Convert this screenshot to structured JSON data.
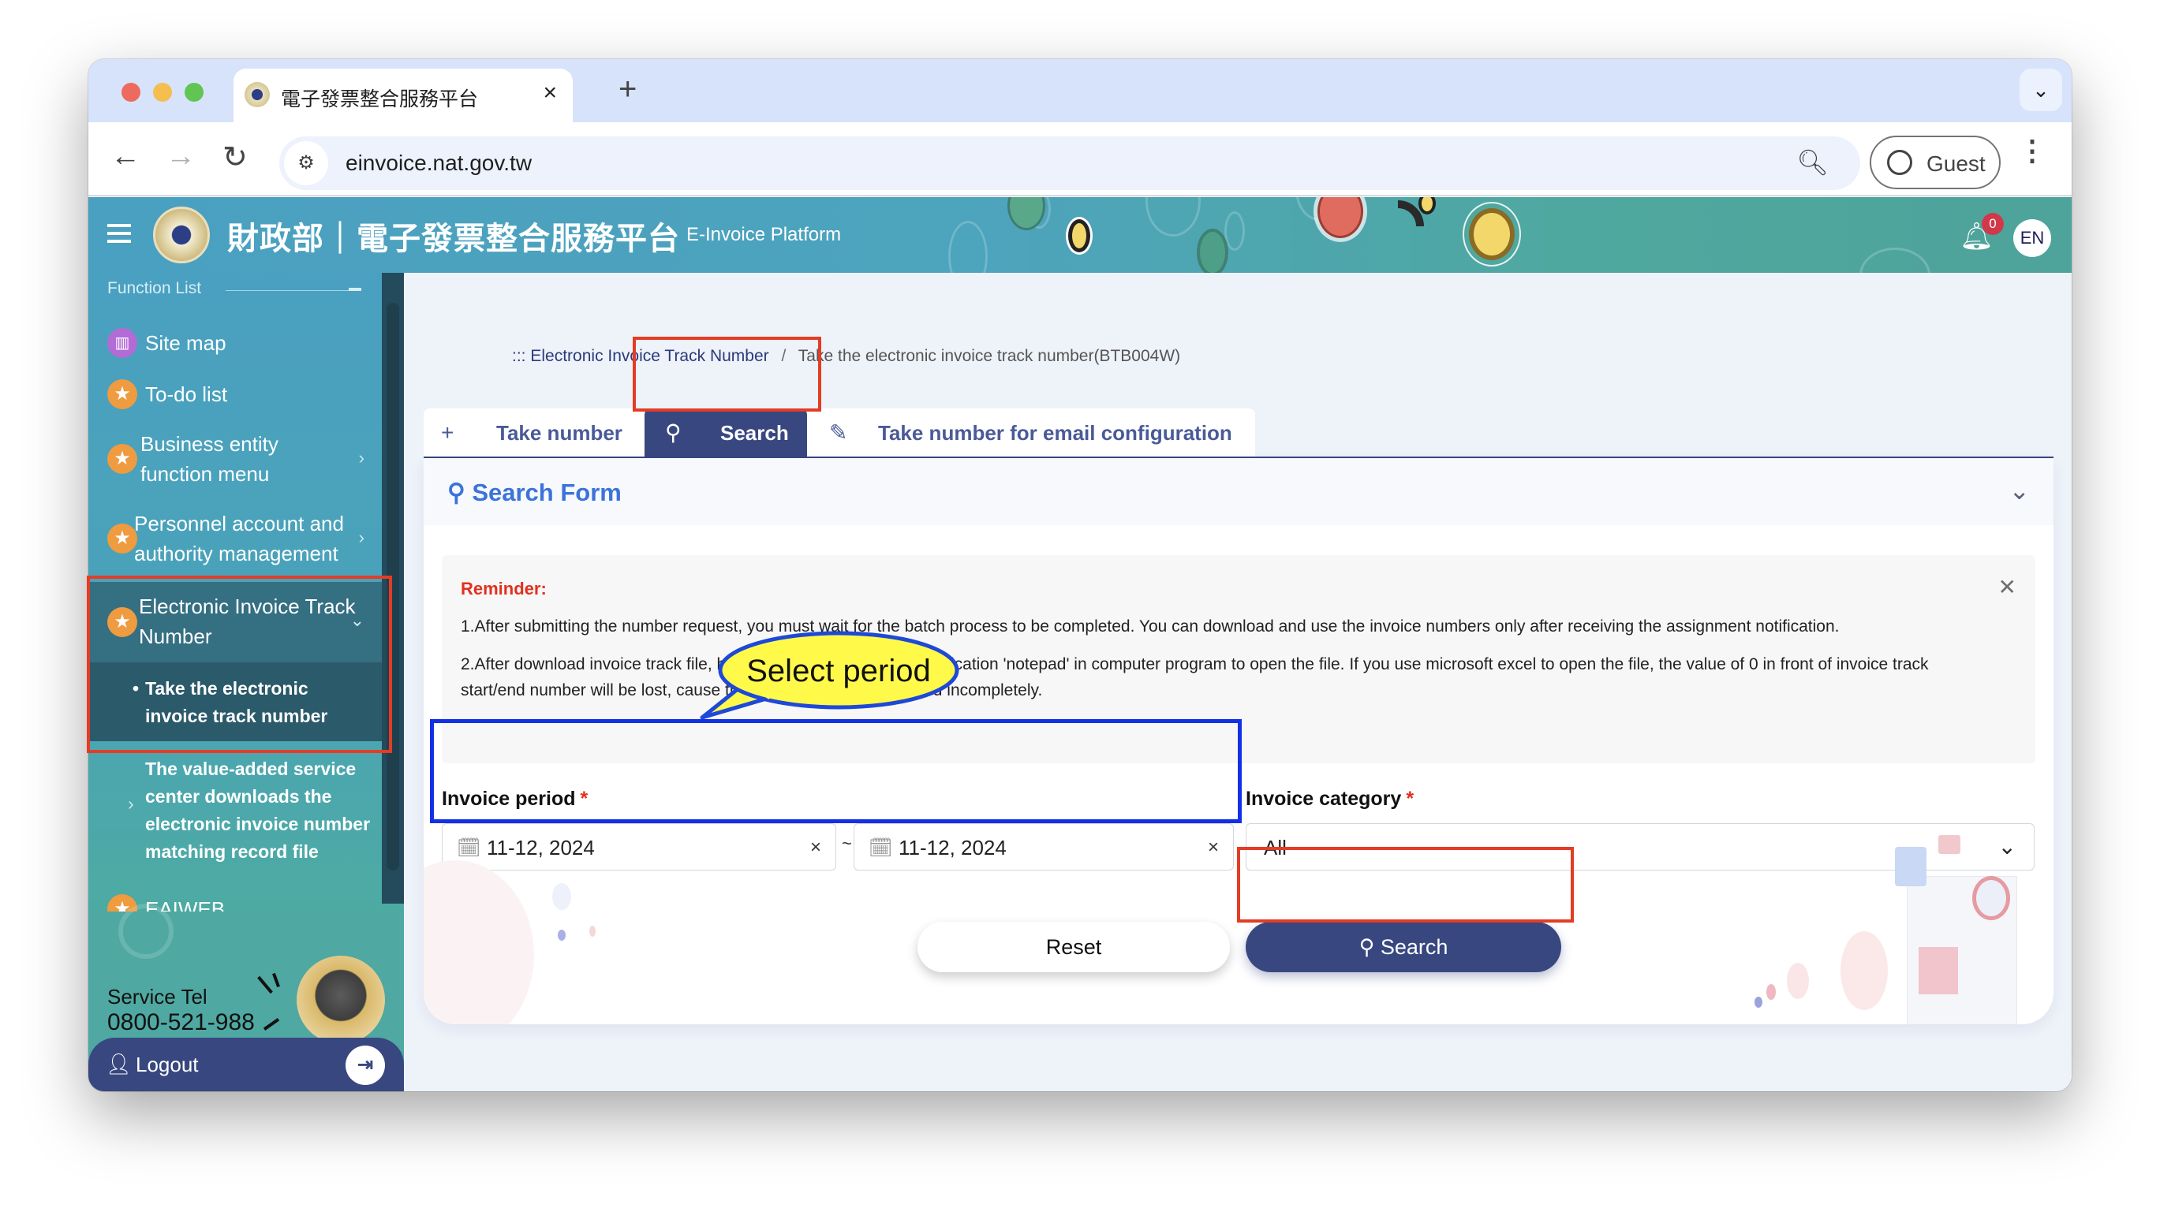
{
  "browser": {
    "tab_title": "電子發票整合服務平台",
    "url": "einvoice.nat.gov.tw",
    "profile_label": "Guest"
  },
  "header": {
    "title": "財政部｜電子發票整合服務平台",
    "subtitle": "E-Invoice Platform",
    "notification_count": "0",
    "language_button": "EN"
  },
  "sidebar": {
    "section_label": "Function List",
    "items": [
      {
        "label": "Site map",
        "icon": "map-icon"
      },
      {
        "label": "To-do list",
        "icon": "star-icon"
      },
      {
        "label": "Business entity function menu",
        "icon": "star-icon"
      },
      {
        "label": "Personnel account and authority management",
        "icon": "star-icon"
      },
      {
        "label": "Electronic Invoice Track Number",
        "icon": "star-icon",
        "expanded": true
      },
      {
        "label": "EAIWEB",
        "icon": "star-icon"
      }
    ],
    "subitems": [
      {
        "label": "Take the electronic invoice track number",
        "active": true
      },
      {
        "label": "The value-added service center downloads the electronic invoice number matching record file"
      }
    ],
    "service_tel_label": "Service Tel",
    "service_tel": "0800-521-988",
    "logout_label": "Logout"
  },
  "breadcrumb": {
    "prefix": ":::",
    "parent": "Electronic Invoice Track Number",
    "separator": "/",
    "current": "Take the electronic invoice track number(BTB004W)"
  },
  "tabs": [
    {
      "label": "Take number",
      "icon": "plus-icon",
      "active": false
    },
    {
      "label": "Search",
      "icon": "search-icon",
      "active": true
    },
    {
      "label": "Take number for email configuration",
      "icon": "edit-icon",
      "active": false
    }
  ],
  "search_form": {
    "title": "Search Form",
    "reminder": {
      "title": "Reminder:",
      "lines": [
        "1.After submitting the number request, you must wait for the batch process to be completed. You can download and use the invoice numbers only after receiving the assignment notification.",
        "2.After download invoice track file, be sure to use the auxiliary application 'notepad' in computer program to open the file. If you use microsoft excel to open the file, the value of 0 in front of invoice track start/end number will be lost, cause the track number to displayed incompletely."
      ]
    },
    "invoice_period": {
      "label": "Invoice period",
      "required_mark": "*",
      "start": "11-12, 2024",
      "end": "11-12, 2024",
      "separator": "~"
    },
    "invoice_category": {
      "label": "Invoice category",
      "required_mark": "*",
      "selected": "All"
    },
    "reset_label": "Reset",
    "search_label": "Search"
  },
  "annotation": {
    "callout_text": "Select period"
  },
  "colors": {
    "primary": "#38477f",
    "accent_blue": "#3b73d9",
    "reminder_red": "#e1301f",
    "highlight_red": "#e43c25",
    "highlight_blue": "#1330e6",
    "callout_yellow": "#fff94a"
  }
}
